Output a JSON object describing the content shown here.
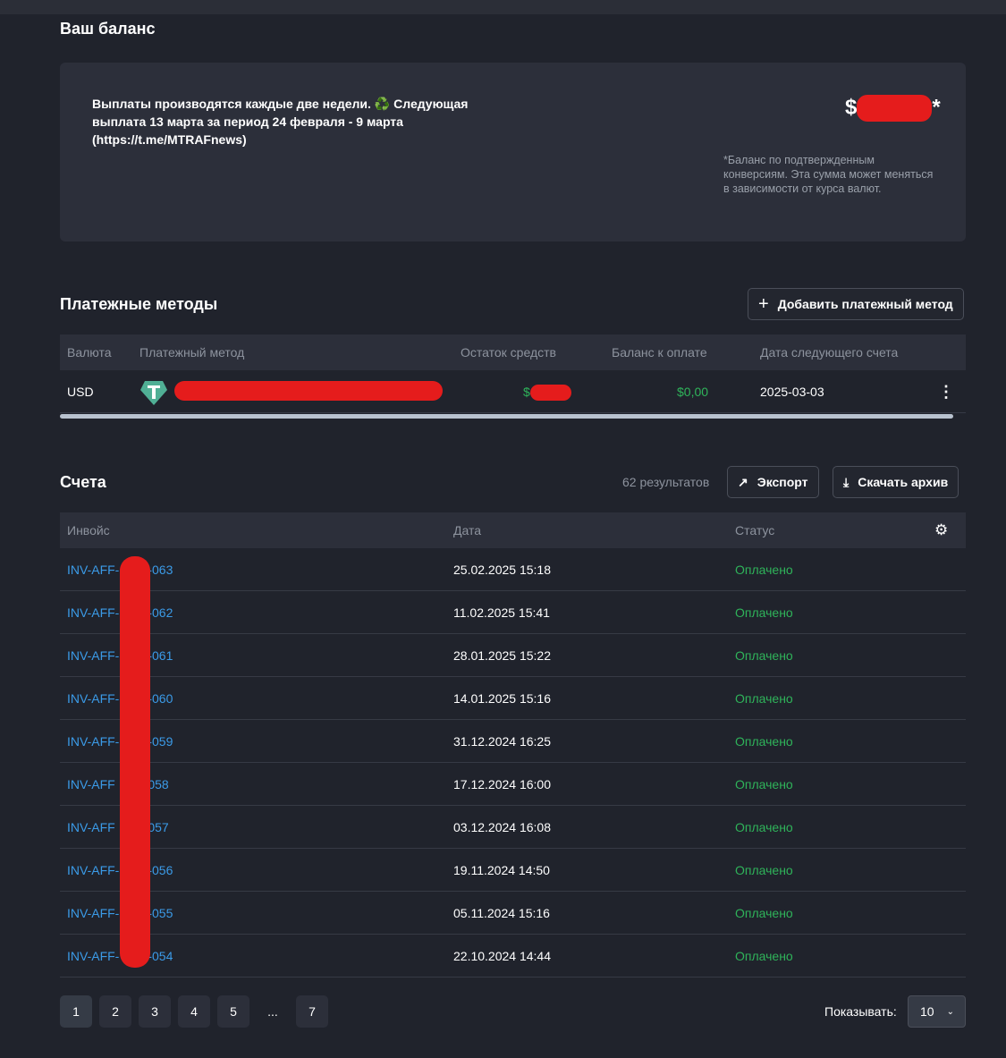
{
  "balance": {
    "title": "Ваш баланс",
    "notice": "Выплаты производятся каждые две недели. ♻️ Следующая выплата 13 марта за период 24 февраля - 9 марта (https://t.me/MTRAFnews)",
    "currency_symbol": "$",
    "asterisk": "*",
    "footnote": "*Баланс по подтвержденным конверсиям. Эта сумма может меняться в зависимости от курса валют."
  },
  "payment_methods": {
    "title": "Платежные методы",
    "add_button": "Добавить платежный метод",
    "columns": [
      "Валюта",
      "Платежный метод",
      "Остаток средств",
      "Баланс к оплате",
      "Дата следующего счета"
    ],
    "row": {
      "currency": "USD",
      "icon": "tether-icon",
      "remaining_prefix": "$",
      "due": "$0,00",
      "next_date": "2025-03-03"
    }
  },
  "invoices": {
    "title": "Счета",
    "count": "62  результатов",
    "export": "Экспорт",
    "download": "Скачать архив",
    "columns": [
      "Инвойс",
      "Дата",
      "Статус"
    ],
    "rows": [
      {
        "prefix": "INV-AFF-",
        "suffix": "-063",
        "date": "25.02.2025 15:18",
        "status": "Оплачено"
      },
      {
        "prefix": "INV-AFF-",
        "suffix": "-062",
        "date": "11.02.2025 15:41",
        "status": "Оплачено"
      },
      {
        "prefix": "INV-AFF-",
        "suffix": "-061",
        "date": "28.01.2025 15:22",
        "status": "Оплачено"
      },
      {
        "prefix": "INV-AFF-",
        "suffix": "-060",
        "date": "14.01.2025 15:16",
        "status": "Оплачено"
      },
      {
        "prefix": "INV-AFF-",
        "suffix": "-059",
        "date": "31.12.2024 16:25",
        "status": "Оплачено"
      },
      {
        "prefix": "INV-AFF",
        "suffix": "-058",
        "date": "17.12.2024 16:00",
        "status": "Оплачено"
      },
      {
        "prefix": "INV-AFF",
        "suffix": "-057",
        "date": "03.12.2024 16:08",
        "status": "Оплачено"
      },
      {
        "prefix": "INV-AFF-",
        "suffix": "-056",
        "date": "19.11.2024 14:50",
        "status": "Оплачено"
      },
      {
        "prefix": "INV-AFF-",
        "suffix": "-055",
        "date": "05.11.2024 15:16",
        "status": "Оплачено"
      },
      {
        "prefix": "INV-AFF-",
        "suffix": "-054",
        "date": "22.10.2024 14:44",
        "status": "Оплачено"
      }
    ]
  },
  "pagination": {
    "pages": [
      "1",
      "2",
      "3",
      "4",
      "5",
      "...",
      "7"
    ],
    "current": "1",
    "show_label": "Показывать:",
    "page_size": "10"
  },
  "colors": {
    "link": "#3b9be8",
    "paid": "#2fb35a",
    "redaction": "#e51c1c"
  }
}
